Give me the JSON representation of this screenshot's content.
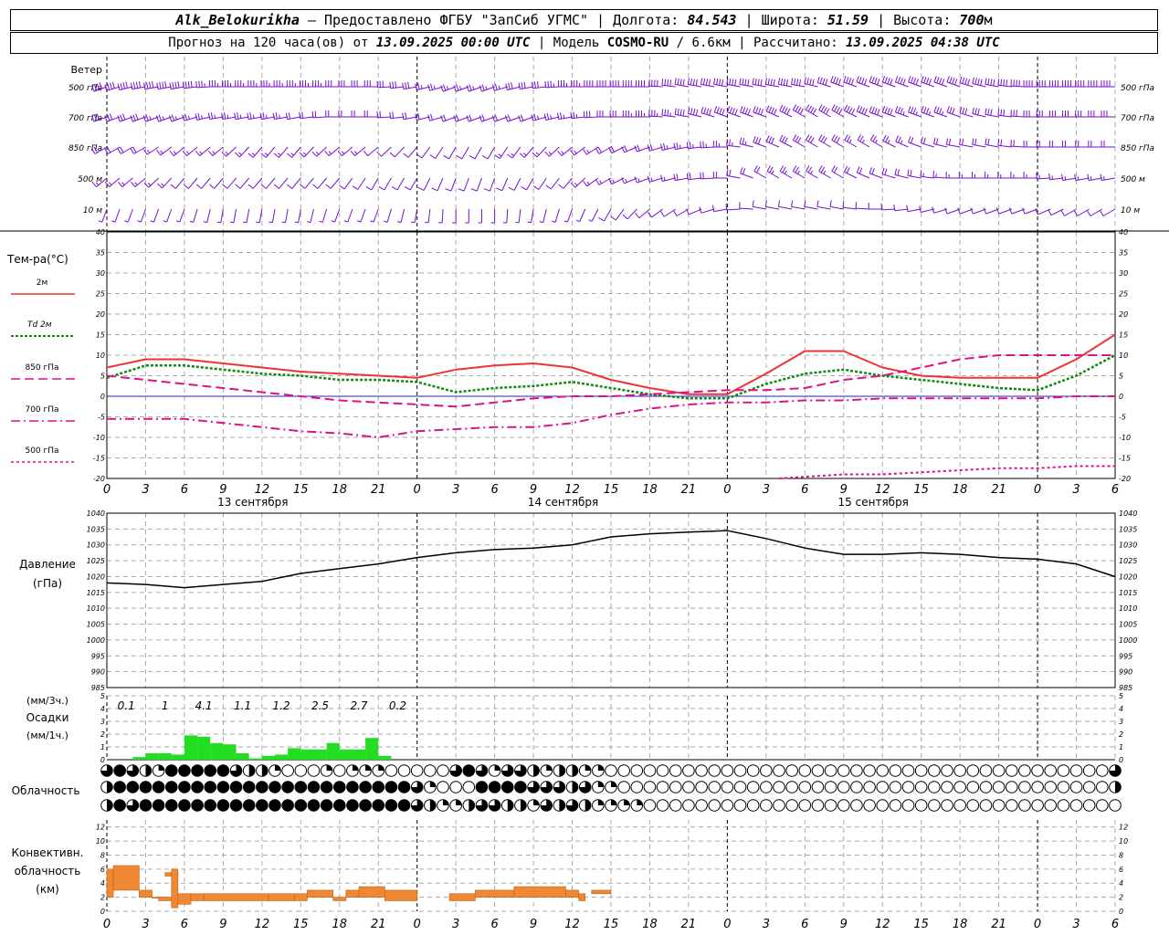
{
  "header": {
    "station": "Alk_Belokurikha",
    "provider": "Предоставлено ФГБУ \"ЗапСиб УГМС\"",
    "lon_label": "Долгота:",
    "lon": "84.543",
    "lat_label": "Широта:",
    "lat": "51.59",
    "alt_label": "Высота:",
    "alt": "700",
    "alt_unit": "м",
    "forecast_label": "Прогноз на 120 часа(ов) от",
    "forecast_start": "13.09.2025 00:00 UTC",
    "model_label": "Модель",
    "model": "COSMO-RU",
    "model_res": "/ 6.6км",
    "calc_label": "Рассчитано:",
    "calc_time": "13.09.2025 04:38 UTC"
  },
  "panels": {
    "wind": {
      "title": "Ветер",
      "levels": [
        "500 гПа",
        "700 гПа",
        "850 гПа",
        "500 м",
        "10 м"
      ]
    },
    "temp": {
      "title": "Тем-ра(°C)",
      "legend": [
        "2м",
        "Td 2м",
        "850 гПа",
        "700 гПа",
        "500 гПа"
      ]
    },
    "pressure": {
      "title1": "Давление",
      "title2": "(гПа)"
    },
    "precip": {
      "title1": "(мм/3ч.)",
      "title2": "Осадки",
      "title3": "(мм/1ч.)"
    },
    "cloud": {
      "title": "Облачность"
    },
    "conv": {
      "title1": "Конвективн.",
      "title2": "облачность",
      "title3": "(км)"
    }
  },
  "day_labels": [
    "13 сентября",
    "14 сентября",
    "15 сентября"
  ],
  "x_ticks": [
    "0",
    "3",
    "6",
    "9",
    "12",
    "15",
    "18",
    "21",
    "0",
    "3",
    "6",
    "9",
    "12",
    "15",
    "18",
    "21",
    "0",
    "3",
    "6",
    "9",
    "12",
    "15",
    "18",
    "21",
    "0",
    "3",
    "6"
  ],
  "colors": {
    "t2m": "#ee3333",
    "td2m": "#118811",
    "t850": "#dd1188",
    "t700": "#dd1188",
    "t500": "#dd1188",
    "wind": "#7711cc",
    "precip": "#22dd22",
    "conv": "#ee8833",
    "pressure": "#000000",
    "grid": "#aaaaaa"
  },
  "chart_data": [
    {
      "type": "line",
      "title": "Тем-ра(°C)",
      "x_hours": [
        0,
        3,
        6,
        9,
        12,
        15,
        18,
        21,
        24,
        27,
        30,
        33,
        36,
        39,
        42,
        45,
        48,
        51,
        54,
        57,
        60,
        63,
        66,
        69,
        72,
        75,
        78
      ],
      "ylim": [
        -20,
        40
      ],
      "series": [
        {
          "name": "2м",
          "values": [
            7,
            9,
            9,
            8,
            7,
            6,
            5.5,
            5,
            4.5,
            6.5,
            7.5,
            8,
            7,
            4,
            2,
            0.5,
            0.5,
            5.5,
            11,
            11,
            7,
            5,
            4.5,
            4.5,
            4.5,
            9,
            15
          ]
        },
        {
          "name": "Td 2м",
          "values": [
            4.5,
            7.5,
            7.5,
            6.5,
            5.5,
            5,
            4,
            4,
            3.5,
            1,
            2,
            2.5,
            3.5,
            2,
            0.5,
            -0.5,
            -0.5,
            3,
            5.5,
            6.5,
            5,
            4,
            3,
            2,
            1.5,
            5,
            10
          ]
        },
        {
          "name": "850 гПа",
          "values": [
            5,
            4,
            3,
            2,
            1,
            0,
            -1,
            -1.5,
            -2,
            -2.5,
            -1.5,
            -0.5,
            0,
            0,
            0.5,
            1,
            1.5,
            1.5,
            2,
            4,
            5,
            7,
            9,
            10,
            10,
            10,
            10
          ]
        },
        {
          "name": "700 гПа",
          "values": [
            -5.5,
            -5.5,
            -5.5,
            -6.5,
            -7.5,
            -8.5,
            -9,
            -10,
            -8.5,
            -8,
            -7.5,
            -7.5,
            -6.5,
            -4.5,
            -3,
            -2,
            -1.5,
            -1.5,
            -1,
            -1,
            -0.5,
            -0.5,
            -0.5,
            -0.5,
            -0.5,
            0,
            0
          ]
        },
        {
          "name": "500 гПа",
          "x_hours": [
            52,
            57,
            60,
            63,
            66,
            69,
            72,
            75,
            78
          ],
          "values": [
            -20,
            -19,
            -19,
            -18.5,
            -18,
            -17.5,
            -17.5,
            -17,
            -17
          ]
        }
      ]
    },
    {
      "type": "line",
      "title": "Давление (гПа)",
      "x_hours": [
        0,
        3,
        6,
        9,
        12,
        15,
        18,
        21,
        24,
        27,
        30,
        33,
        36,
        39,
        42,
        45,
        48,
        51,
        54,
        57,
        60,
        63,
        66,
        69,
        72,
        75,
        78
      ],
      "ylim": [
        985,
        1040
      ],
      "series": [
        {
          "name": "Давление",
          "values": [
            1018,
            1017.5,
            1016.5,
            1017.5,
            1018.5,
            1021,
            1022.5,
            1024,
            1026,
            1027.5,
            1028.5,
            1029,
            1030,
            1032.5,
            1033.5,
            1034,
            1034.5,
            1032,
            1029,
            1027,
            1027,
            1027.5,
            1027,
            1026,
            1025.5,
            1024,
            1020
          ]
        }
      ]
    },
    {
      "type": "bar",
      "title": "Осадки",
      "sums_3h": [
        "0.1",
        "1",
        "4.1",
        "1.1",
        "1.2",
        "2.5",
        "2.7",
        "0.2"
      ],
      "hourly_mm": [
        0,
        0,
        0.2,
        0.5,
        0.5,
        0.4,
        1.9,
        1.8,
        1.3,
        1.2,
        0.5,
        0.1,
        0.3,
        0.4,
        0.9,
        0.8,
        0.8,
        1.3,
        0.8,
        0.8,
        1.7,
        0.3,
        0,
        0
      ],
      "ylim": [
        0,
        5
      ]
    },
    {
      "type": "heatmap",
      "title": "Облачность",
      "rows": [
        "high",
        "middle",
        "low"
      ],
      "cover_quarters_every_hour_0_to_78": {
        "high": "3432144444322100010111000003431332122110000000000000000000000000000000000000003",
        "middle": "2444444444444444444444443100044443332311000000000000000000000000000000000000002",
        "low": "2434444444444444444444443211233221323211110000000000000000000000000000000000000"
      }
    },
    {
      "type": "bar",
      "title": "Конвективн. облачность (км)",
      "ylim": [
        0,
        13
      ],
      "segments_hours_base_top": [
        [
          0,
          0.5,
          2,
          6
        ],
        [
          0.5,
          2.5,
          3,
          6.5
        ],
        [
          2.5,
          3.5,
          2,
          3
        ],
        [
          3.5,
          4.5,
          2,
          2
        ],
        [
          4,
          5,
          1.5,
          2
        ],
        [
          4.5,
          4.5,
          5,
          5.5
        ],
        [
          5,
          5.5,
          0.5,
          6
        ],
        [
          5.5,
          6.5,
          1,
          2.5
        ],
        [
          6.5,
          7.5,
          1.5,
          2.5
        ],
        [
          7.5,
          12.5,
          1.5,
          2.5
        ],
        [
          12.5,
          14.5,
          1.5,
          2.5
        ],
        [
          14.5,
          15.5,
          1.5,
          2.5
        ],
        [
          15.5,
          17.5,
          2,
          3
        ],
        [
          17.5,
          18.5,
          1.5,
          2
        ],
        [
          18.5,
          19.5,
          2,
          3
        ],
        [
          19.5,
          21.5,
          2,
          3.5
        ],
        [
          21.5,
          24,
          1.5,
          3
        ],
        [
          26.5,
          28.5,
          1.5,
          2.5
        ],
        [
          28.5,
          31.5,
          2,
          3
        ],
        [
          31.5,
          35.5,
          2,
          3.5
        ],
        [
          35.5,
          36.5,
          2,
          3
        ],
        [
          36.5,
          37,
          1.5,
          2.5
        ],
        [
          37.5,
          39,
          2.5,
          3
        ]
      ]
    },
    {
      "type": "scatter",
      "title": "Ветер",
      "levels": [
        "500 гПа",
        "700 гПа",
        "850 гПа",
        "500 м",
        "10 м"
      ],
      "dir_deg_every_3h_0_to_78": {
        "500 гПа": [
          250,
          260,
          260,
          270,
          270,
          270,
          270,
          270,
          260,
          250,
          250,
          260,
          270,
          270,
          270,
          280,
          280,
          280,
          280,
          290,
          290,
          290,
          290,
          280,
          270,
          270,
          270
        ],
        "700 гПа": [
          250,
          250,
          250,
          260,
          260,
          260,
          270,
          270,
          260,
          250,
          250,
          250,
          260,
          270,
          270,
          280,
          290,
          290,
          300,
          300,
          290,
          290,
          290,
          280,
          270,
          270,
          270
        ],
        "850 гПа": [
          240,
          240,
          230,
          230,
          220,
          220,
          230,
          230,
          220,
          210,
          210,
          220,
          230,
          240,
          250,
          260,
          270,
          290,
          300,
          300,
          300,
          290,
          280,
          280,
          270,
          270,
          270
        ],
        "500 м": [
          230,
          230,
          220,
          220,
          220,
          220,
          220,
          210,
          210,
          200,
          200,
          210,
          220,
          240,
          250,
          260,
          270,
          300,
          300,
          300,
          290,
          280,
          270,
          270,
          270,
          260,
          260
        ],
        "10 м": [
          200,
          200,
          200,
          190,
          190,
          190,
          200,
          200,
          190,
          180,
          180,
          190,
          200,
          210,
          230,
          240,
          260,
          280,
          280,
          280,
          270,
          260,
          250,
          250,
          250,
          240,
          240
        ]
      },
      "speed_ms_every_3h_0_to_78": {
        "500 гПа": [
          20,
          22,
          20,
          18,
          18,
          17,
          16,
          15,
          14,
          12,
          13,
          15,
          18,
          20,
          22,
          24,
          26,
          28,
          30,
          30,
          28,
          26,
          24,
          22,
          22,
          22,
          22
        ],
        "700 гПа": [
          14,
          14,
          13,
          12,
          12,
          11,
          11,
          10,
          10,
          9,
          10,
          11,
          13,
          15,
          17,
          19,
          21,
          22,
          23,
          22,
          20,
          18,
          16,
          15,
          15,
          15,
          15
        ],
        "850 гПа": [
          9,
          9,
          8,
          8,
          7,
          7,
          7,
          6,
          6,
          5,
          6,
          7,
          8,
          9,
          10,
          12,
          13,
          14,
          15,
          14,
          12,
          11,
          10,
          10,
          10,
          10,
          10
        ],
        "500 м": [
          7,
          7,
          6,
          6,
          5,
          5,
          5,
          5,
          5,
          4,
          5,
          5,
          6,
          7,
          8,
          9,
          10,
          11,
          12,
          11,
          10,
          9,
          8,
          8,
          8,
          8,
          8
        ],
        "10 м": [
          3,
          3,
          3,
          3,
          2,
          2,
          2,
          2,
          2,
          2,
          2,
          3,
          3,
          4,
          4,
          5,
          5,
          6,
          6,
          6,
          5,
          5,
          4,
          4,
          4,
          4,
          4
        ]
      }
    }
  ]
}
